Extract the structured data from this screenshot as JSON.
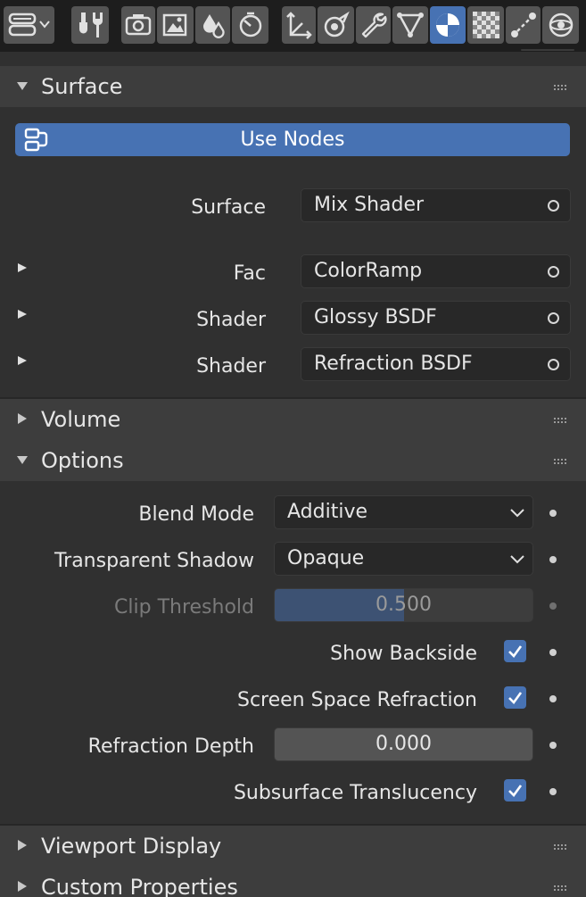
{
  "toolbar": {
    "buttons": [
      {
        "icon": "editor-type-icon"
      },
      {
        "icon": "tool-settings-icon"
      },
      {
        "icon": "render-properties-icon"
      },
      {
        "icon": "output-properties-icon"
      },
      {
        "icon": "view-layer-properties-icon"
      },
      {
        "icon": "scene-properties-icon"
      },
      {
        "icon": "object-properties-icon"
      },
      {
        "icon": "physics-properties-icon"
      },
      {
        "icon": "modifier-properties-icon"
      },
      {
        "icon": "object-data-properties-icon"
      },
      {
        "icon": "material-properties-icon"
      },
      {
        "icon": "texture-properties-icon"
      },
      {
        "icon": "constraint-properties-icon"
      },
      {
        "icon": "world-properties-icon"
      }
    ],
    "active": "material-properties-icon"
  },
  "surface_panel": {
    "title": "Surface",
    "use_nodes_label": "Use Nodes",
    "surface_label": "Surface",
    "surface_value": "Mix Shader",
    "inputs": [
      {
        "label": "Fac",
        "value": "ColorRamp"
      },
      {
        "label": "Shader",
        "value": "Glossy BSDF"
      },
      {
        "label": "Shader",
        "value": "Refraction BSDF"
      }
    ]
  },
  "volume_panel": {
    "title": "Volume"
  },
  "options_panel": {
    "title": "Options",
    "blend_mode_label": "Blend Mode",
    "blend_mode_value": "Additive",
    "transparent_shadow_label": "Transparent Shadow",
    "transparent_shadow_value": "Opaque",
    "clip_threshold_label": "Clip Threshold",
    "clip_threshold_value": "0.500",
    "clip_threshold_fraction": 0.5,
    "show_backside_label": "Show Backside",
    "show_backside_checked": true,
    "ssr_label": "Screen Space Refraction",
    "ssr_checked": true,
    "refraction_depth_label": "Refraction Depth",
    "refraction_depth_value": "0.000",
    "subsurface_label": "Subsurface Translucency",
    "subsurface_checked": true
  },
  "viewport_display_panel": {
    "title": "Viewport Display"
  },
  "custom_properties_panel": {
    "title": "Custom Properties"
  },
  "colors": {
    "accent": "#4772b3",
    "panel_header": "#3d3d3d",
    "panel_body": "#303030",
    "field": "#282828"
  }
}
